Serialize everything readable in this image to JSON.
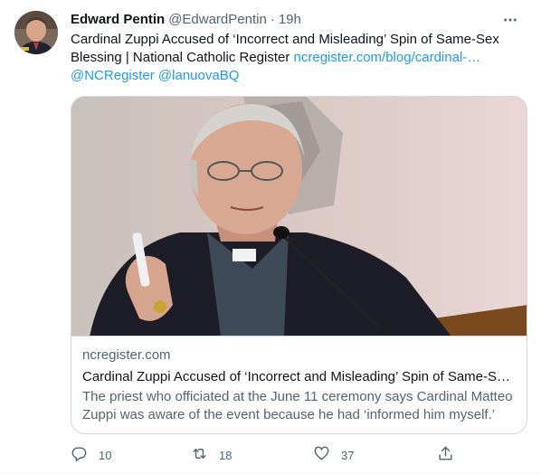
{
  "tweet": {
    "author_name": "Edward Pentin",
    "author_handle": "@EdwardPentin",
    "separator": "·",
    "time": "19h",
    "text_main": "Cardinal Zuppi Accused of ‘Incorrect and Misleading’ Spin of Same-Sex Blessing | National Catholic Register ",
    "link_url": "ncregister.com/blog/cardinal-…",
    "mention_1": "@NCRegister",
    "mention_2": "@lanuovaBQ"
  },
  "card": {
    "domain": "ncregister.com",
    "title": "Cardinal Zuppi Accused of ‘Incorrect and Misleading’ Spin of Same-S…",
    "description": "The priest who officiated at the June 11 ceremony says Cardinal Matteo Zuppi was aware of the event because he had ‘informed him myself.’"
  },
  "actions": {
    "reply_count": "10",
    "retweet_count": "18",
    "like_count": "37"
  },
  "icons": {
    "more": "more-horizontal-icon",
    "reply": "reply-icon",
    "retweet": "retweet-icon",
    "like": "heart-icon",
    "share": "share-icon"
  },
  "colors": {
    "link": "#1d9bf0",
    "secondary_text": "#536471",
    "border": "#cfd9de"
  }
}
